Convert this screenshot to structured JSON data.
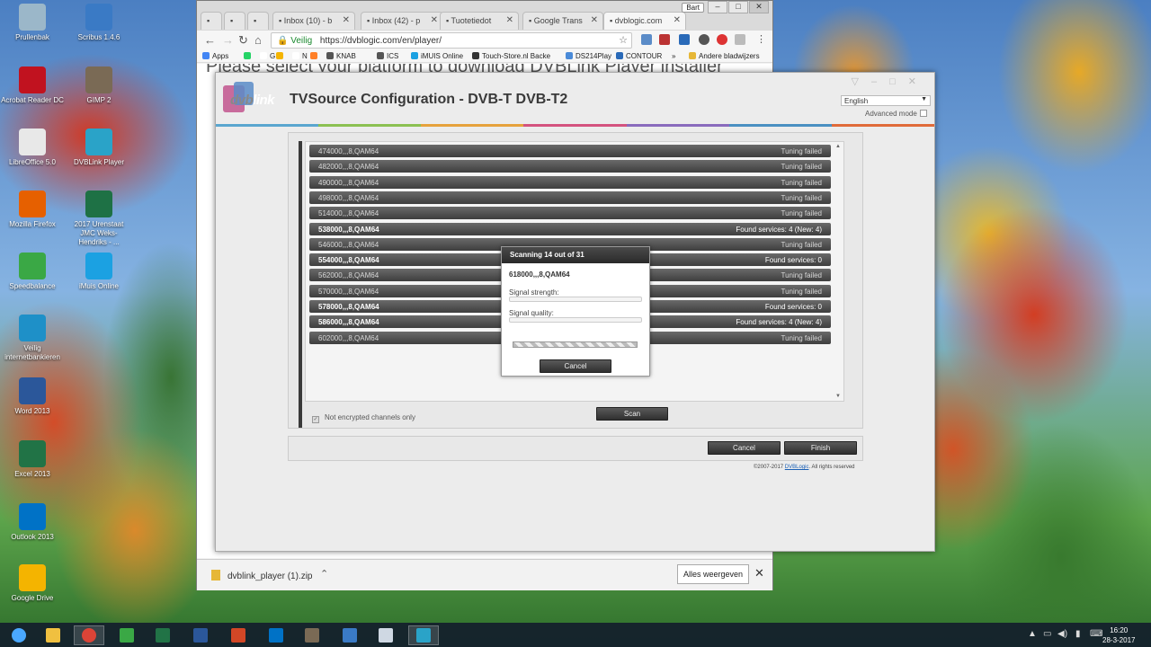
{
  "desktop": {
    "icons": [
      {
        "label": "Prullenbak",
        "icon": "recycle-bin-icon",
        "color": "#9bb7c9"
      },
      {
        "label": "Scribus 1.4.6",
        "icon": "scribus-icon",
        "color": "#3a7ac5"
      },
      {
        "label": "Acrobat Reader DC",
        "icon": "acrobat-icon",
        "color": "#c1121f"
      },
      {
        "label": "GIMP 2",
        "icon": "gimp-icon",
        "color": "#7a6a55"
      },
      {
        "label": "LibreOffice 5.0",
        "icon": "document-icon",
        "color": "#e8e8e8"
      },
      {
        "label": "DVBLink Player",
        "icon": "dvblink-icon",
        "color": "#2aa3c8"
      },
      {
        "label": "Mozilla Firefox",
        "icon": "firefox-icon",
        "color": "#e66000"
      },
      {
        "label": "2017 Urenstaat JMC Weks-Hendriks - ...",
        "icon": "excel-icon",
        "color": "#1e7145"
      },
      {
        "label": "Speedbalance",
        "icon": "speedbalance-icon",
        "color": "#3aa845"
      },
      {
        "label": "iMuis Online",
        "icon": "imuis-icon",
        "color": "#1ba1e2"
      },
      {
        "label": "Veilig internetbankieren",
        "icon": "bank-icon",
        "color": "#1e90c8"
      },
      {
        "label": "Word 2013",
        "icon": "word-icon",
        "color": "#2b579a"
      },
      {
        "label": "Excel 2013",
        "icon": "excel-icon",
        "color": "#217346"
      },
      {
        "label": "Outlook 2013",
        "icon": "outlook-icon",
        "color": "#0072c6"
      },
      {
        "label": "Google Drive",
        "icon": "drive-icon",
        "color": "#f4b400"
      }
    ]
  },
  "browser": {
    "tabs": [
      {
        "label": "",
        "icon": "blank-tab-icon"
      },
      {
        "label": "",
        "icon": "app-tab-icon"
      },
      {
        "label": "",
        "icon": "doc-tab-icon"
      },
      {
        "label": "Inbox (10) - b",
        "icon": "gmail-icon"
      },
      {
        "label": "Inbox (42) - p",
        "icon": "gmail-icon"
      },
      {
        "label": "Tuotetiedot",
        "icon": "page-icon"
      },
      {
        "label": "Google Trans",
        "icon": "translate-icon"
      },
      {
        "label": "dvblogic.com",
        "icon": "dvblink-icon"
      }
    ],
    "user_badge": "Bart",
    "omnibox": {
      "secure_label": "Veilig",
      "url": "https://dvblogic.com/en/player/"
    },
    "bookmarks": [
      {
        "label": "Apps",
        "color": "#4285f4"
      },
      {
        "label": "",
        "color": "#25d366"
      },
      {
        "label": "G",
        "color": "#ffffff"
      },
      {
        "label": "",
        "color": "#f4b400"
      },
      {
        "label": "N",
        "color": "#ffffff"
      },
      {
        "label": "",
        "color": "#ff7f27"
      },
      {
        "label": "KNAB",
        "color": "#555555"
      },
      {
        "label": "ICS",
        "color": "#555555"
      },
      {
        "label": "iMUIS Online",
        "color": "#1ba1e2"
      },
      {
        "label": "Touch-Store.nl Backe",
        "color": "#333333"
      },
      {
        "label": "DS214Play",
        "color": "#4a8ad8"
      },
      {
        "label": "CONTOUR",
        "color": "#2a6ab8"
      },
      {
        "label": "»",
        "color": "#f6f6f6"
      },
      {
        "label": "Andere bladwijzers",
        "color": "#e6b737"
      }
    ],
    "page_heading": "Please select your platform to download DVBLink Player installer",
    "download": {
      "filename": "dvblink_player (1).zip",
      "show_all": "Alles weergeven"
    }
  },
  "app": {
    "logo_text": "dvb",
    "logo_text2": "link",
    "title": "TVSource Configuration - DVB-T DVB-T2",
    "language": "English",
    "advanced_mode": "Advanced mode",
    "stripe_colors": [
      "#5aa6cf",
      "#8cc152",
      "#e6a23c",
      "#d4537f",
      "#8a6bbd",
      "#4a90c2",
      "#e06b3a"
    ],
    "channels": [
      {
        "freq": "474000,,,8,QAM64",
        "status": "Tuning failed",
        "found": false
      },
      {
        "freq": "482000,,,8,QAM64",
        "status": "Tuning failed",
        "found": false
      },
      {
        "freq": "490000,,,8,QAM64",
        "status": "Tuning failed",
        "found": false
      },
      {
        "freq": "498000,,,8,QAM64",
        "status": "Tuning failed",
        "found": false
      },
      {
        "freq": "514000,,,8,QAM64",
        "status": "Tuning failed",
        "found": false
      },
      {
        "freq": "538000,,,8,QAM64",
        "status": "Found services: 4 (New: 4)",
        "found": true
      },
      {
        "freq": "546000,,,8,QAM64",
        "status": "Tuning failed",
        "found": false
      },
      {
        "freq": "554000,,,8,QAM64",
        "status": "Found services:  0",
        "found": true
      },
      {
        "freq": "562000,,,8,QAM64",
        "status": "Tuning failed",
        "found": false
      },
      {
        "freq": "570000,,,8,QAM64",
        "status": "Tuning failed",
        "found": false
      },
      {
        "freq": "578000,,,8,QAM64",
        "status": "Found services:  0",
        "found": true
      },
      {
        "freq": "586000,,,8,QAM64",
        "status": "Found services: 4 (New: 4)",
        "found": true
      },
      {
        "freq": "602000,,,8,QAM64",
        "status": "Tuning failed",
        "found": false
      }
    ],
    "not_encrypted_label": "Not encrypted channels only",
    "scan_label": "Scan",
    "cancel_label": "Cancel",
    "finish_label": "Finish",
    "copyright_prefix": "©2007-2017 ",
    "copyright_link": "DVBLogic",
    "copyright_suffix": ". All rights reserved",
    "modal": {
      "title": "Scanning 14 out of 31",
      "frequency": "618000,,,8,QAM64",
      "signal_strength_label": "Signal strength:",
      "signal_quality_label": "Signal quality:",
      "cancel_label": "Cancel"
    }
  },
  "taskbar": {
    "apps": [
      {
        "icon": "windows-start-icon",
        "color": "#4aa8ff"
      },
      {
        "icon": "file-explorer-icon",
        "color": "#f0c040"
      },
      {
        "icon": "chrome-icon",
        "color": "#db4437"
      },
      {
        "icon": "speedbalance-icon",
        "color": "#3aa845"
      },
      {
        "icon": "excel-icon",
        "color": "#217346"
      },
      {
        "icon": "word-icon",
        "color": "#2b579a"
      },
      {
        "icon": "powerpoint-icon",
        "color": "#d24726"
      },
      {
        "icon": "outlook-icon",
        "color": "#0072c6"
      },
      {
        "icon": "gimp-icon",
        "color": "#7a6a55"
      },
      {
        "icon": "scribus-icon",
        "color": "#3a7ac5"
      },
      {
        "icon": "document-icon",
        "color": "#cfd8e3"
      },
      {
        "icon": "dvblink-icon",
        "color": "#2aa3c8"
      }
    ],
    "time": "16:20",
    "date": "28-3-2017"
  }
}
